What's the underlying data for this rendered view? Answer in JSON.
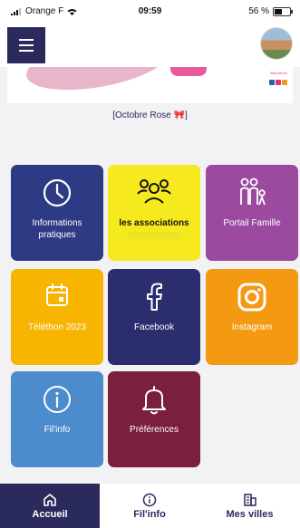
{
  "status_bar": {
    "carrier": "Orange F",
    "time": "09:59",
    "battery": "56 %",
    "battery_level": 0.56
  },
  "header": {
    "menu_icon": "hamburger-icon",
    "avatar": "city-avatar"
  },
  "banner": {
    "brand_lines": [
      "Bienvenue",
      "Ville de",
      "Bagnols"
    ]
  },
  "notice": {
    "text": "[Octobre Rose 🎀]"
  },
  "tiles": [
    {
      "label": "Informations pratiques",
      "icon": "clock-icon"
    },
    {
      "label": "les associations",
      "icon": "people-group-icon"
    },
    {
      "label": "Portail Famille",
      "icon": "family-icon"
    },
    {
      "label": "Téléthon 2023",
      "icon": "calendar-icon"
    },
    {
      "label": "Facebook",
      "icon": "facebook-icon"
    },
    {
      "label": "Instagram",
      "icon": "instagram-icon"
    },
    {
      "label": "Fil'info",
      "icon": "info-icon"
    },
    {
      "label": "Préférences",
      "icon": "bell-icon"
    }
  ],
  "bottom_nav": [
    {
      "label": "Accueil",
      "icon": "home-icon",
      "active": true
    },
    {
      "label": "Fil'info",
      "icon": "info-icon",
      "active": false
    },
    {
      "label": "Mes villes",
      "icon": "buildings-icon",
      "active": false
    }
  ],
  "colors": {
    "primary": "#2b2a5d",
    "yellow": "#f6ea1f",
    "purple": "#9b4aa0",
    "amber": "#f7b400",
    "orange": "#f39a12",
    "blue": "#4d8ccc",
    "burgundy": "#7a1f3c"
  }
}
